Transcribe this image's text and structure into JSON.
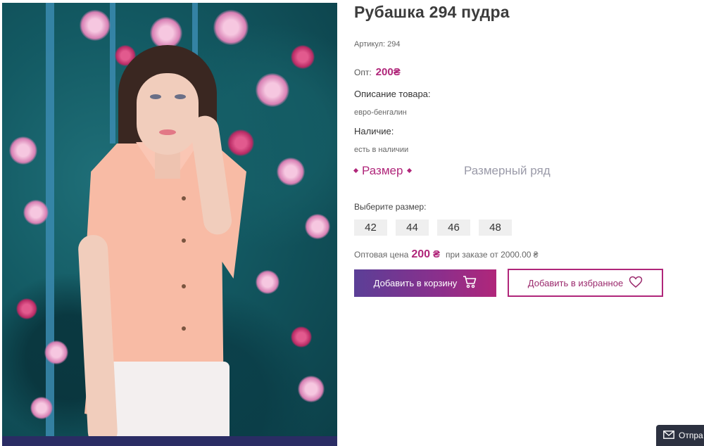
{
  "product": {
    "title": "Рубашка 294 пудра",
    "sku": "Артикул: 294",
    "opt_label": "Опт:",
    "opt_price": "200₴",
    "description_label": "Описание товара:",
    "description_value": "евро-бенгалин",
    "availability_label": "Наличие:",
    "availability_value": "есть в наличии",
    "photo_icon": "product-photo"
  },
  "tabs": {
    "active": "Размер",
    "inactive": "Размерный ряд"
  },
  "sizes": {
    "label": "Выберите размер:",
    "options": [
      "42",
      "44",
      "46",
      "48"
    ]
  },
  "wholesale": {
    "prefix": "Оптовая цена",
    "price": "200",
    "currency": "₴",
    "suffix": "при заказе от 2000.00 ₴"
  },
  "buttons": {
    "add_to_cart": "Добавить в корзину",
    "add_to_favorites": "Добавить в избранное"
  },
  "widget": {
    "send_label": "Отпра"
  },
  "colors": {
    "accent": "#b0267a",
    "cart_gradient_start": "#5b3f97"
  }
}
